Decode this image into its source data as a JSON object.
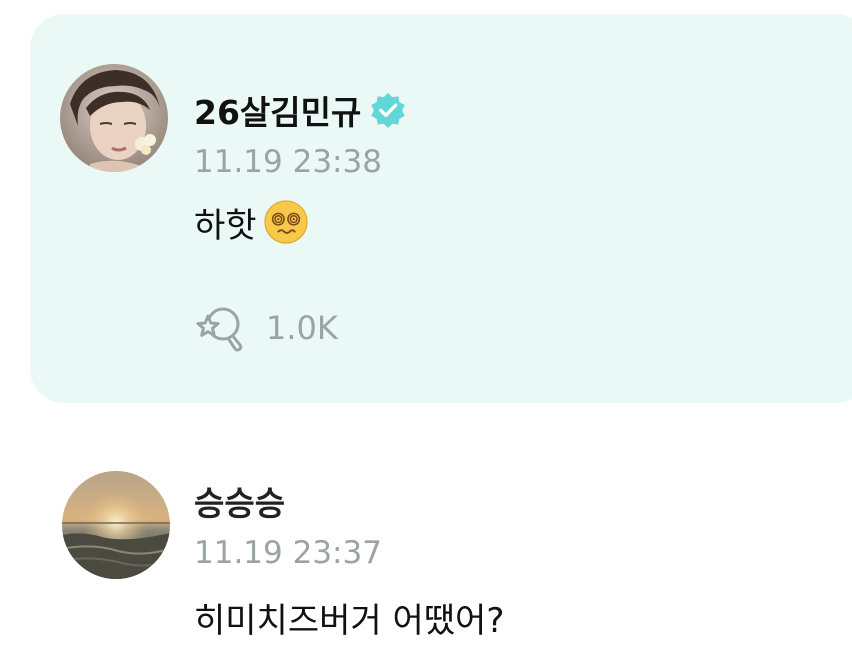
{
  "post": {
    "author_name": "26살김민규",
    "verified": true,
    "timestamp": "11.19 23:38",
    "message_text": "하핫",
    "emoji": "dizzy-face-emoji",
    "reaction_count": "1.0K"
  },
  "comment": {
    "author_name": "승승승",
    "timestamp": "11.19 23:37",
    "message_text": "히미치즈버거 어땠어?"
  },
  "colors": {
    "card_background": "#ebf9f6",
    "verified_badge": "#63d6d8",
    "muted_text": "#9aa3a6"
  }
}
